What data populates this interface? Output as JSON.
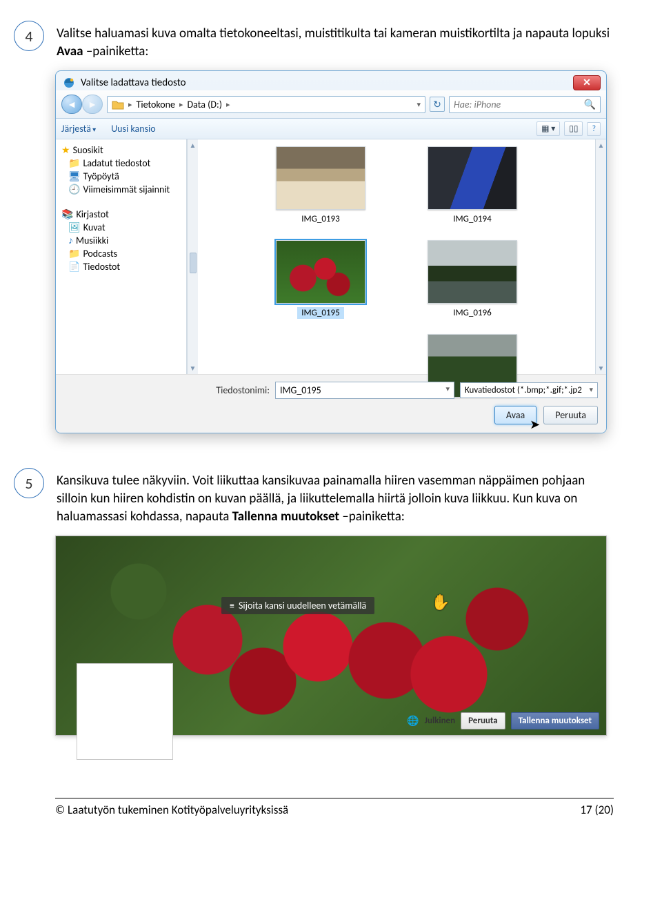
{
  "step4": {
    "num": "4",
    "pre": "Valitse haluamasi kuva omalta tietokoneeltasi, muistitikulta tai kameran muistikortilta ja napauta lopuksi ",
    "bold": "Avaa",
    "post": " –painiketta:"
  },
  "dialog": {
    "title": "Valitse ladattava tiedosto",
    "breadcrumb": {
      "seg1": "Tietokone",
      "seg2": "Data (D:)"
    },
    "search": {
      "placeholder": "Hae: iPhone"
    },
    "toolbar": {
      "organize": "Järjestä",
      "newfolder": "Uusi kansio"
    },
    "tree": {
      "fav": "Suosikit",
      "downloads": "Ladatut tiedostot",
      "desktop": "Työpöytä",
      "recent": "Viimeisimmät sijainnit",
      "libs": "Kirjastot",
      "pictures": "Kuvat",
      "music": "Musiikki",
      "podcasts": "Podcasts",
      "files": "Tiedostot"
    },
    "thumbs": [
      "IMG_0193",
      "IMG_0194",
      "IMG_0195",
      "IMG_0196"
    ],
    "filename_label": "Tiedostonimi:",
    "filename_value": "IMG_0195",
    "filetype": "Kuvatiedostot (*.bmp;*.gif;*.jp2",
    "open": "Avaa",
    "cancel": "Peruuta"
  },
  "step5": {
    "num": "5",
    "t1": "Kansikuva tulee näkyviin. Voit liikuttaa kansikuvaa painamalla hiiren vasemman näppäimen pohjaan silloin kun hiiren kohdistin on kuvan päällä, ja liikuttelemalla hiirtä jolloin kuva liikkuu. Kun kuva on haluamassasi kohdassa, napauta ",
    "bold": "Tallenna muutokset",
    "t2": " –painiketta:"
  },
  "cover": {
    "overlay": "Sijoita kansi uudelleen vetämällä",
    "privacy": "Julkinen",
    "cancel": "Peruuta",
    "save": "Tallenna muutokset"
  },
  "footer": {
    "left": "© Laatutyön tukeminen Kotityöpalveluyrityksissä",
    "right": "17 (20)"
  }
}
